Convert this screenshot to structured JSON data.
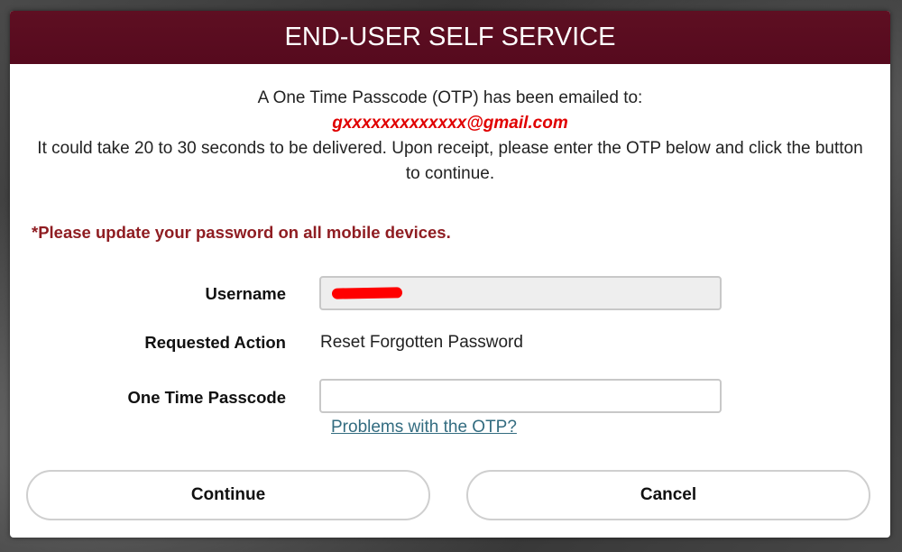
{
  "dialog": {
    "title": "END-USER SELF SERVICE",
    "intro_line1": "A One Time Passcode (OTP) has been emailed to:",
    "email": "gxxxxxxxxxxxxx@gmail.com",
    "intro_line2": "It could take 20 to 30 seconds to be delivered. Upon receipt, please enter the OTP below and click the button to continue.",
    "notice": "*Please update your password on all mobile devices."
  },
  "form": {
    "username_label": "Username",
    "username_value": "",
    "action_label": "Requested Action",
    "action_value": "Reset Forgotten Password",
    "otp_label": "One Time Passcode",
    "otp_value": "",
    "otp_help_link": "Problems with the OTP?"
  },
  "buttons": {
    "continue_label": "Continue",
    "cancel_label": "Cancel"
  },
  "colors": {
    "header_bg": "#5a0c20",
    "email_text": "#e00000",
    "notice_text": "#8f1d22",
    "link_text": "#336c80"
  }
}
